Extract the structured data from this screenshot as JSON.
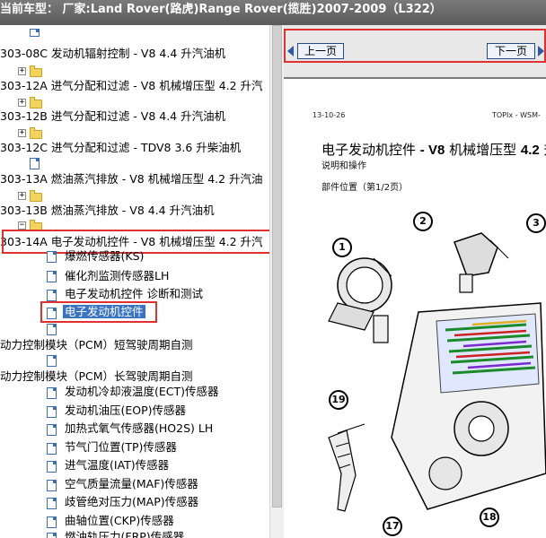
{
  "window": {
    "title": "当前车型： 厂家:Land Rover(路虎)Range Rover(揽胜)2007-2009（L322）"
  },
  "tree": {
    "rows": [
      {
        "label": "303-08C 发动机辐射控制 - V8 4.4 升汽油机"
      },
      {
        "label": "303-12A 进气分配和过滤 - V8 机械增压型 4.2 升汽"
      },
      {
        "label": "303-12B 进气分配和过滤 - V8 4.4 升汽油机"
      },
      {
        "label": "303-12C 进气分配和过滤 - TDV8 3.6 升柴油机"
      },
      {
        "label": "303-13A 燃油蒸汽排放 - V8 机械增压型 4.2 升汽油"
      },
      {
        "label": "303-13B 燃油蒸汽排放 - V8 4.4 升汽油机"
      },
      {
        "label": "303-14A 电子发动机控件 - V8 机械增压型 4.2 升汽"
      }
    ],
    "children": [
      {
        "label": "爆燃传感器(KS)"
      },
      {
        "label": "催化剂监测传感器LH"
      },
      {
        "label": "电子发动机控件 诊断和测试"
      },
      {
        "label": "电子发动机控件"
      }
    ],
    "pcm_short": "动力控制模块（PCM）短驾驶周期自测",
    "pcm_long": "动力控制模块（PCM）长驾驶周期自测",
    "sensors": [
      {
        "label": "发动机冷却液温度(ECT)传感器"
      },
      {
        "label": "发动机油压(EOP)传感器"
      },
      {
        "label": "加热式氧气传感器(HO2S) LH"
      },
      {
        "label": "节气门位置(TP)传感器"
      },
      {
        "label": "进气温度(IAT)传感器"
      },
      {
        "label": "空气质量流量(MAF)传感器"
      },
      {
        "label": "歧管绝对压力(MAP)传感器"
      },
      {
        "label": "曲轴位置(CKP)传感器"
      },
      {
        "label": "燃油轨压力(FRP)传感器"
      }
    ]
  },
  "viewer": {
    "prev_label": "上一页",
    "next_label": "下一页",
    "page_code": "13-10-26",
    "page_source": "TOPIx - WSM-",
    "title_prefix": "电子发动机控件",
    "title_bold": "- V8",
    "title_suffix": "机械增压型",
    "title_num": "4.2",
    "title_tail": "升汽",
    "subtitle": "说明和操作",
    "location": "部件位置（第1/2页）",
    "callouts": [
      "1",
      "2",
      "3",
      "19",
      "17",
      "18"
    ]
  },
  "colors": {
    "titlebar": "#606060",
    "selection": "#3c74c4",
    "highlight": "#e03030"
  }
}
